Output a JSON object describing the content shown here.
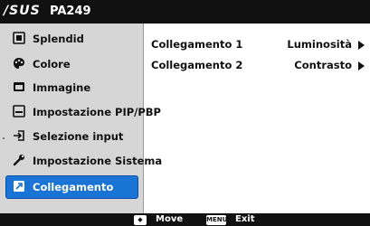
{
  "header": {
    "logo_text": "/SUS",
    "model": "PA249"
  },
  "sidebar": {
    "items": [
      {
        "label": "Splendid",
        "icon": "splendid-icon"
      },
      {
        "label": "Colore",
        "icon": "palette-icon"
      },
      {
        "label": "Immagine",
        "icon": "image-icon"
      },
      {
        "label": "Impostazione PIP/PBP",
        "icon": "pip-icon"
      },
      {
        "label": "Selezione input",
        "icon": "input-icon"
      },
      {
        "label": "Impostazione Sistema",
        "icon": "wrench-icon"
      },
      {
        "label": "Collegamento",
        "icon": "shortcut-icon"
      }
    ],
    "selected_index": 6
  },
  "main": {
    "rows": [
      {
        "name": "Collegamento 1",
        "value": "Luminosità"
      },
      {
        "name": "Collegamento 2",
        "value": "Contrasto"
      }
    ]
  },
  "footer": {
    "move_key": "◆",
    "move_label": "Move",
    "exit_key": "MENU",
    "exit_label": "Exit"
  },
  "colors": {
    "accent": "#1a74d6",
    "sidebar_bg": "#d6d6d6",
    "bar_bg": "#111111"
  }
}
